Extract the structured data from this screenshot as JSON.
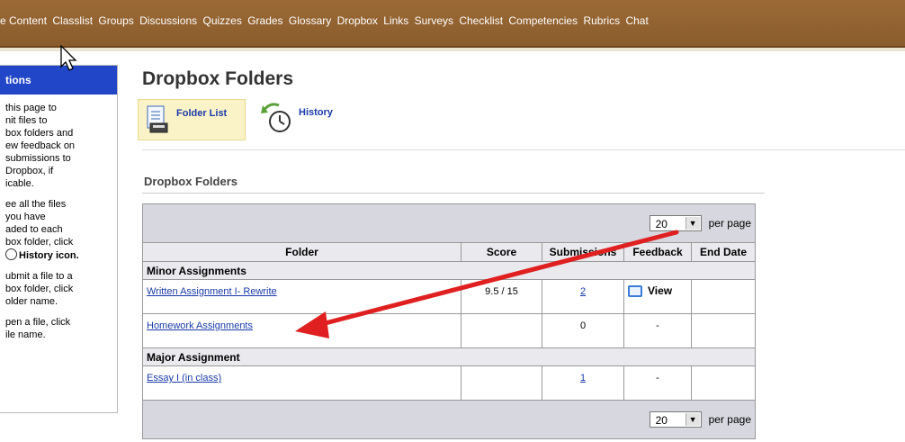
{
  "nav": {
    "items": [
      "e Content",
      "Classlist",
      "Groups",
      "Discussions",
      "Quizzes",
      "Grades",
      "Glossary",
      "Dropbox",
      "Links",
      "Surveys",
      "Checklist",
      "Competencies",
      "Rubrics",
      "Chat"
    ]
  },
  "sidebar": {
    "title": "tions",
    "paragraphs": [
      "this page to\nnit files to\nbox folders and\new feedback on\nsubmissions to\nDropbox, if\nicable.",
      "ee all the files\nyou have\naded to each\nbox folder, click",
      "ubmit a file to a\nbox folder, click\nolder name.",
      "pen a file, click\nile name."
    ],
    "history_icon_label": "History icon."
  },
  "page": {
    "title": "Dropbox Folders",
    "tab_folder_list": "Folder List",
    "tab_history": "History",
    "section_title": "Dropbox Folders"
  },
  "table": {
    "per_page_value": "20",
    "per_page_label": "per page",
    "headers": [
      "Folder",
      "Score",
      "Submissions",
      "Feedback",
      "End Date"
    ],
    "groups": [
      {
        "name": "Minor Assignments",
        "rows": [
          {
            "folder": "Written Assignment I- Rewrite",
            "score": "9.5 / 15",
            "submissions": "2",
            "feedback": "View",
            "end_date": ""
          },
          {
            "folder": "Homework Assignments",
            "score": "",
            "submissions": "0",
            "feedback": "-",
            "end_date": ""
          }
        ]
      },
      {
        "name": "Major Assignment",
        "rows": [
          {
            "folder": "Essay I (in class)",
            "score": "",
            "submissions": "1",
            "feedback": "-",
            "end_date": ""
          }
        ]
      }
    ]
  },
  "colors": {
    "nav_bg": "#9b6a36",
    "sidebar_head": "#2146c7",
    "link": "#1a3aa8",
    "annotation_arrow": "#e02020"
  },
  "icons": {
    "folder_list": "folder-list-icon",
    "history": "history-clock-icon",
    "feedback": "speech-bubble-icon",
    "dropdown": "chevron-down-icon"
  }
}
